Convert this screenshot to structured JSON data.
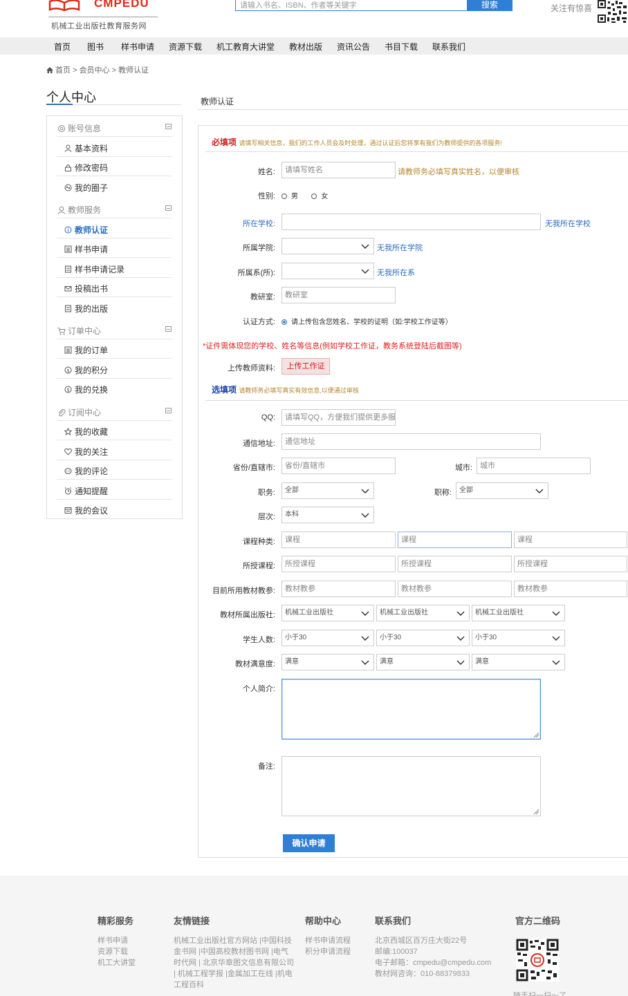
{
  "header": {
    "logo_text": "CMPEDU",
    "logo_sub": "机械工业出版社教育服务网",
    "search_placeholder": "请输入书名、ISBN、作者等关键字",
    "search_button": "搜索",
    "follow_text": "关注有惊喜"
  },
  "nav": [
    "首页",
    "图书",
    "样书申请",
    "资源下载",
    "机工教育大讲堂",
    "教材出版",
    "资讯公告",
    "书目下载",
    "联系我们"
  ],
  "breadcrumb": {
    "home": "首页",
    "member": "会员中心",
    "current": "教师认证",
    "sep": ">"
  },
  "sidebar": {
    "title": "个人中心",
    "groups": [
      {
        "label": "账号信息",
        "items": [
          "基本资料",
          "修改密码",
          "我的圈子"
        ]
      },
      {
        "label": "教师服务",
        "items": [
          "教师认证",
          "样书申请",
          "样书申请记录",
          "投稿出书",
          "我的出版"
        ]
      },
      {
        "label": "订单中心",
        "items": [
          "我的订单",
          "我的积分",
          "我的兑换"
        ]
      },
      {
        "label": "订阅中心",
        "items": [
          "我的收藏",
          "我的关注",
          "我的评论",
          "通知提醒",
          "我的会议"
        ]
      }
    ],
    "active_item": "教师认证"
  },
  "main": {
    "title": "教师认证",
    "required": {
      "title": "必填项",
      "desc": "请填写相关信息，我们的工作人员会及时处理，通过认证后您将享有我们为教师提供的各项服务!"
    },
    "name": {
      "label": "姓名:",
      "placeholder": "请填写姓名",
      "hint": "请教师务必填写真实姓名，以便审核"
    },
    "gender": {
      "label": "性别:",
      "options": [
        "男",
        "女"
      ]
    },
    "school": {
      "label": "所在学校:",
      "link": "无我所在学校"
    },
    "college": {
      "label": "所属学院:",
      "link": "无我所在学院"
    },
    "department": {
      "label": "所属系(所):",
      "link": "无我所在系"
    },
    "office": {
      "label": "教研室:",
      "placeholder": "教研室"
    },
    "auth": {
      "label": "认证方式:",
      "option": "请上传包含您姓名、学校的证明（如:学校工作证等）"
    },
    "warning": "*证件需体现您的学校、姓名等信息(例如学校工作证，教务系统登陆后截图等)",
    "upload": {
      "label": "上传教师资料:",
      "button": "上传工作证"
    },
    "optional": {
      "title": "选填项",
      "desc": "请教师务必填写真实有效信息,以便通过审核"
    },
    "qq": {
      "label": "QQ:",
      "placeholder": "请填写QQ，方便我们提供更多服务"
    },
    "address": {
      "label": "通信地址:",
      "placeholder": "通信地址"
    },
    "province": {
      "label": "省份/直辖市:",
      "placeholder": "省份/直辖市"
    },
    "city": {
      "label": "城市:",
      "placeholder": "城市"
    },
    "duty": {
      "label": "职务:",
      "value": "全部"
    },
    "title_rank": {
      "label": "职称:",
      "value": "全部"
    },
    "level": {
      "label": "层次:",
      "value": "本科"
    },
    "course_type": {
      "label": "课程种类:",
      "placeholders": [
        "课程",
        "课程",
        "课程"
      ]
    },
    "course_taught": {
      "label": "所授课程:",
      "placeholders": [
        "所授课程",
        "所授课程",
        "所授课程"
      ]
    },
    "textbook": {
      "label": "目前所用教材教参:",
      "placeholders": [
        "教材教参",
        "教材教参",
        "教材教参"
      ]
    },
    "publisher": {
      "label": "教材所属出版社:",
      "values": [
        "机械工业出版社",
        "机械工业出版社",
        "机械工业出版社"
      ]
    },
    "students": {
      "label": "学生人数:",
      "values": [
        "小于30",
        "小于30",
        "小于30"
      ]
    },
    "satisfaction": {
      "label": "教材满意度:",
      "values": [
        "满意",
        "满意",
        "满意"
      ]
    },
    "intro": {
      "label": "个人简介:"
    },
    "remark": {
      "label": "备注:"
    },
    "submit": "确认申请"
  },
  "footer": {
    "services": {
      "title": "精彩服务",
      "links": [
        "样书申请",
        "资源下载",
        "机工大讲堂"
      ]
    },
    "friends": {
      "title": "友情链接",
      "lines": [
        "机械工业出版社官方网站 |中国科技",
        "金书网 |中国高校教材图书网 |电气",
        "时代网 | 北京华章图文信息有限公司",
        "| 机械工程学报 |金属加工在线 |机电",
        "工程百科"
      ]
    },
    "help": {
      "title": "帮助中心",
      "links": [
        "样书申请流程",
        "积分申请流程"
      ]
    },
    "contact": {
      "title": "联系我们",
      "lines": [
        "北京西城区百万庄大街22号",
        "邮编:100037",
        "电子邮箱：cmpedu@cmpedu.com",
        "教材网咨询：010-88379833"
      ]
    },
    "qr": {
      "title": "官方二维码",
      "scan": "随手扫一扫～了"
    }
  },
  "colors": {
    "brand_red": "#e0281b",
    "primary_blue": "#2f7fd6",
    "link_blue": "#2c6cc0",
    "hint_gold": "#b5852d",
    "warn_red": "#e02020",
    "required_red": "#d02020",
    "optional_blue": "#1a3fae"
  }
}
